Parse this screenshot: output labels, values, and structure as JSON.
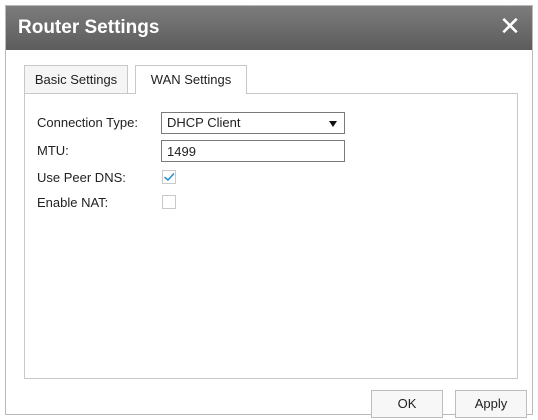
{
  "dialog": {
    "title": "Router Settings",
    "close_glyph": "✕"
  },
  "tabs": [
    {
      "label": "Basic Settings",
      "active": false
    },
    {
      "label": "WAN Settings",
      "active": true
    }
  ],
  "form": {
    "connection_type": {
      "label": "Connection Type:",
      "value": "DHCP Client"
    },
    "mtu": {
      "label": "MTU:",
      "value": "1499"
    },
    "use_peer_dns": {
      "label": "Use Peer DNS:",
      "checked": true
    },
    "enable_nat": {
      "label": "Enable NAT:",
      "checked": false
    }
  },
  "buttons": {
    "ok": "OK",
    "apply": "Apply"
  },
  "colors": {
    "titlebar": "#6b6b6b",
    "checkmark": "#2a8fd6"
  }
}
